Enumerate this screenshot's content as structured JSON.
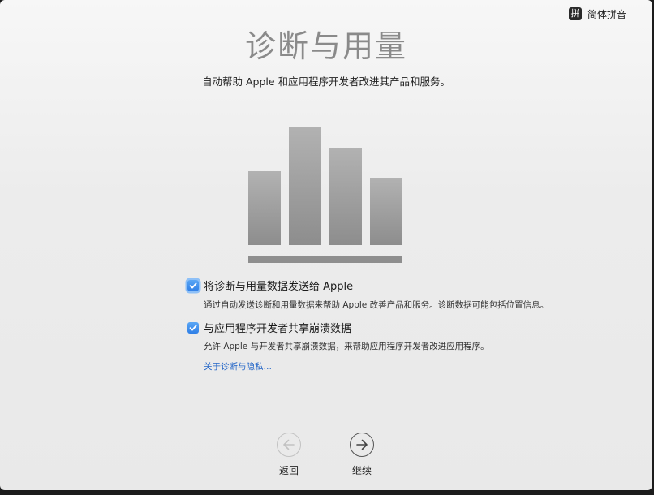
{
  "input_menu": {
    "icon_glyph": "拼",
    "label": "简体拼音"
  },
  "page": {
    "title": "诊断与用量",
    "subtitle": "自动帮助 Apple 和应用程序开发者改进其产品和服务。"
  },
  "options": [
    {
      "label": "将诊断与用量数据发送给 Apple",
      "checked": true,
      "description": "通过自动发送诊断和用量数据来帮助 Apple 改善产品和服务。诊断数据可能包括位置信息。"
    },
    {
      "label": "与应用程序开发者共享崩溃数据",
      "checked": true,
      "description": "允许 Apple 与开发者共享崩溃数据，来帮助应用程序开发者改进应用程序。"
    }
  ],
  "privacy_link": "关于诊断与隐私…",
  "nav": {
    "back_label": "返回",
    "continue_label": "继续"
  },
  "colors": {
    "accent": "#2f7fe6",
    "link": "#2466c7",
    "title": "#8a8a8a"
  },
  "icons": {
    "input_source": "pinyin-input-icon",
    "illustration": "bar-chart-illustration",
    "back": "arrow-left-circle-icon",
    "continue": "arrow-right-circle-icon",
    "checkbox": "checkmark-icon"
  }
}
